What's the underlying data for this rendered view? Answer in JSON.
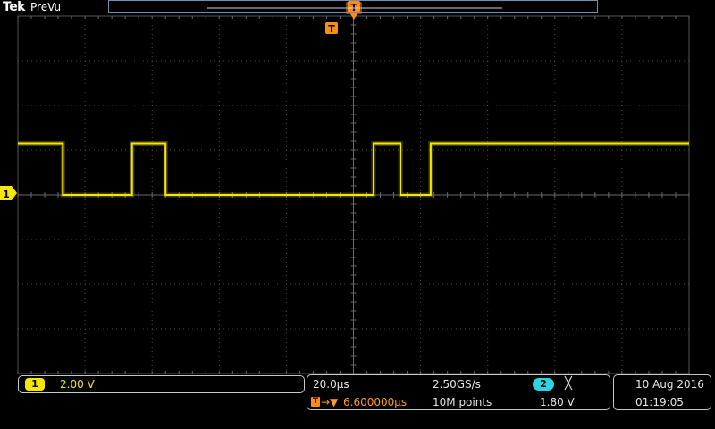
{
  "header": {
    "brand": "Tek",
    "mode": "PreVu"
  },
  "trigger": {
    "marker_label": "T",
    "position_marker_label": "T"
  },
  "channel1": {
    "marker_label": "1",
    "badge_label": "1",
    "scale": "2.00 V",
    "color": "#f5e60a"
  },
  "acquisition": {
    "time_per_div": "20.0µs",
    "sample_rate": "2.50GS/s",
    "trigger_icon_label": "T",
    "trigger_arrow": "→▼",
    "trigger_offset": "6.600000µs",
    "record_length": "10M points",
    "trigger_source_label": "2",
    "trigger_slope_icon": "╳",
    "trigger_level": "1.80 V"
  },
  "datetime": {
    "date": "10 Aug 2016",
    "time": "01:19:05"
  },
  "chart_data": {
    "type": "line",
    "x_unit": "divisions",
    "y_unit": "divisions",
    "xlim": [
      0,
      10
    ],
    "ylim": [
      0,
      8
    ],
    "grid": true,
    "series": [
      {
        "color": "#f5e60a",
        "x": [
          0,
          0.67,
          0.67,
          1.7,
          1.7,
          2.2,
          2.2,
          5.3,
          5.3,
          5.7,
          5.7,
          6.15,
          6.15,
          10
        ],
        "y": [
          5.15,
          5.15,
          4.0,
          4.0,
          5.15,
          5.15,
          4.0,
          4.0,
          5.15,
          5.15,
          4.0,
          4.0,
          5.15,
          5.15
        ]
      }
    ],
    "ground_level": 4.0,
    "trigger_time": 5.0
  }
}
